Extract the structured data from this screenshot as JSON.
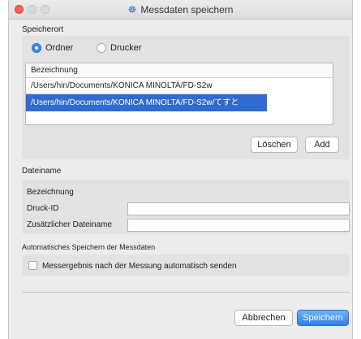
{
  "window": {
    "title": "Messdaten speichern",
    "title_icon": "app-icon"
  },
  "storage": {
    "section_label": "Speicherort",
    "radio_folder": "Ordner",
    "radio_printer": "Drucker",
    "selected": "Ordner",
    "list_header": "Bezeichnung",
    "rows": [
      "/Users/hin/Documents/KONICA MINOLTA/FD-S2w",
      "/Users/hin/Documents/KONICA MINOLTA/FD-S2w/てすと"
    ],
    "selected_row": 1,
    "delete_label": "Löschen",
    "add_label": "Add"
  },
  "filename": {
    "section_label": "Dateiname",
    "col_label": "Bezeichnung",
    "print_id_label": "Druck-ID",
    "print_id_value": "",
    "extra_label": "Zusätzlicher Dateiname",
    "extra_value": ""
  },
  "autosave": {
    "section_label": "Automatisches Speichern der Messdaten",
    "checkbox_label": "Messergebnis nach der Messung automatisch senden",
    "checked": false
  },
  "footer": {
    "cancel_label": "Abbrechen",
    "save_label": "Speichern"
  },
  "colors": {
    "accent": "#2f6bd0",
    "close": "#fc5f57"
  }
}
